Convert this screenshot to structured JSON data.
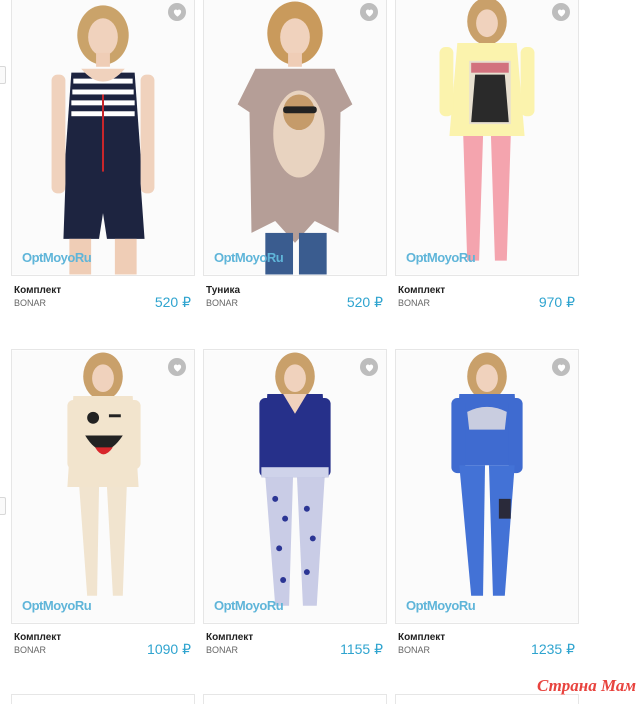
{
  "products": [
    {
      "name": "Комплект",
      "brand": "BONAR",
      "price": "520 ₽",
      "logo": "OptMoyoRu"
    },
    {
      "name": "Туника",
      "brand": "BONAR",
      "price": "520 ₽",
      "logo": "OptMoyoRu"
    },
    {
      "name": "Комплект",
      "brand": "BONAR",
      "price": "970 ₽",
      "logo": "OptMoyoRu"
    },
    {
      "name": "Комплект",
      "brand": "BONAR",
      "price": "1090 ₽",
      "logo": "OptMoyoRu"
    },
    {
      "name": "Комплект",
      "brand": "BONAR",
      "price": "1155 ₽",
      "logo": "OptMoyoRu"
    },
    {
      "name": "Комплект",
      "brand": "BONAR",
      "price": "1235 ₽",
      "logo": "OptMoyoRu"
    }
  ],
  "watermark": "Страна Мам",
  "colors": {
    "price": "#2fa4cf",
    "logo": "#5fb5d9",
    "watermark": "#e8433e"
  },
  "icons": {
    "favorite": "heart-icon"
  }
}
